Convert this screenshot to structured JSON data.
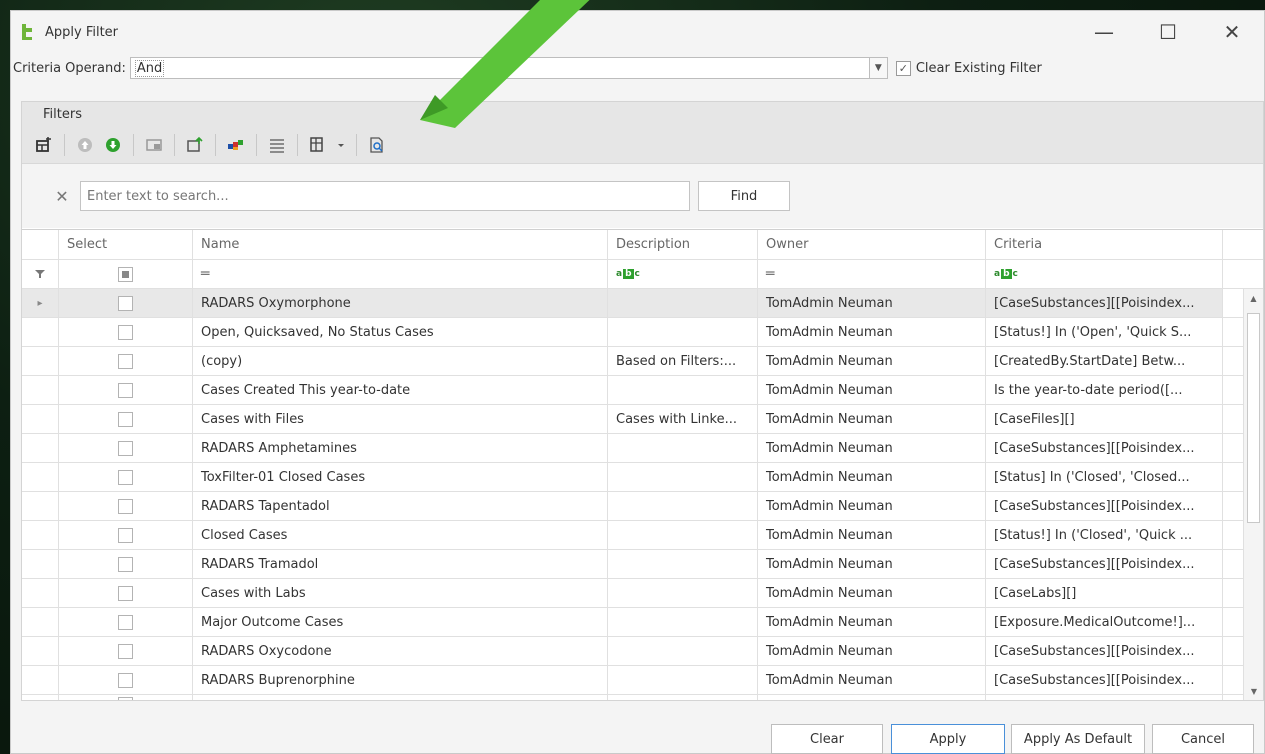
{
  "window": {
    "title": "Apply Filter"
  },
  "criteria": {
    "label": "Criteria Operand:",
    "value": "And",
    "clear_existing_label": "Clear Existing Filter",
    "clear_existing_checked": true
  },
  "group": {
    "title": "Filters"
  },
  "toolbar": {
    "icons": [
      "add-filter-icon",
      "move-up-icon",
      "move-down-icon",
      "view-icon",
      "export-icon",
      "color-icon",
      "lines-icon",
      "layout-icon",
      "dropdown-icon",
      "preview-icon"
    ]
  },
  "search": {
    "placeholder": "Enter text to search...",
    "find_label": "Find"
  },
  "grid": {
    "columns": {
      "select": "Select",
      "name": "Name",
      "description": "Description",
      "owner": "Owner",
      "criteria": "Criteria"
    },
    "rows": [
      {
        "name": "RADARS Oxymorphone",
        "description": "",
        "owner": "TomAdmin Neuman",
        "criteria": "[CaseSubstances][[Poisindex..."
      },
      {
        "name": "Open, Quicksaved, No Status Cases",
        "description": "",
        "owner": "TomAdmin Neuman",
        "criteria": "[Status!] In ('Open', 'Quick S..."
      },
      {
        "name": " (copy)",
        "description": "Based on Filters:...",
        "owner": "TomAdmin Neuman",
        "criteria": "[CreatedBy.StartDate] Betw..."
      },
      {
        "name": "Cases Created This year-to-date",
        "description": "",
        "owner": "TomAdmin Neuman",
        "criteria": "Is the year-to-date period([..."
      },
      {
        "name": "Cases with Files",
        "description": "Cases with Linke...",
        "owner": "TomAdmin Neuman",
        "criteria": "[CaseFiles][]"
      },
      {
        "name": "RADARS Amphetamines",
        "description": "",
        "owner": "TomAdmin Neuman",
        "criteria": "[CaseSubstances][[Poisindex..."
      },
      {
        "name": "ToxFilter-01 Closed Cases",
        "description": "",
        "owner": "TomAdmin Neuman",
        "criteria": "[Status] In ('Closed', 'Closed..."
      },
      {
        "name": "RADARS Tapentadol",
        "description": "",
        "owner": "TomAdmin Neuman",
        "criteria": "[CaseSubstances][[Poisindex..."
      },
      {
        "name": "Closed Cases",
        "description": "",
        "owner": "TomAdmin Neuman",
        "criteria": "[Status!] In ('Closed', 'Quick ..."
      },
      {
        "name": "RADARS Tramadol",
        "description": "",
        "owner": "TomAdmin Neuman",
        "criteria": "[CaseSubstances][[Poisindex..."
      },
      {
        "name": "Cases with Labs",
        "description": "",
        "owner": "TomAdmin Neuman",
        "criteria": "[CaseLabs][]"
      },
      {
        "name": "Major Outcome Cases",
        "description": "",
        "owner": "TomAdmin Neuman",
        "criteria": "[Exposure.MedicalOutcome!]..."
      },
      {
        "name": "RADARS Oxycodone",
        "description": "",
        "owner": "TomAdmin Neuman",
        "criteria": "[CaseSubstances][[Poisindex..."
      },
      {
        "name": "RADARS Buprenorphine",
        "description": "",
        "owner": "TomAdmin Neuman",
        "criteria": "[CaseSubstances][[Poisindex..."
      }
    ]
  },
  "footer": {
    "clear_label": "Clear",
    "apply_label": "Apply",
    "apply_default_label": "Apply As Default",
    "cancel_label": "Cancel"
  },
  "colors": {
    "accent": "#4a90d9",
    "arrow": "#5cc43a",
    "icon_green": "#2ea12e"
  }
}
